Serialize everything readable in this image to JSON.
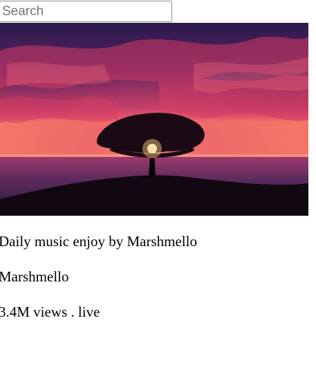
{
  "search": {
    "placeholder": "Search"
  },
  "video": {
    "thumbnail_alt": "Tree at sunset",
    "title": "Daily music enjoy by Marshmello",
    "channel": "Marshmello",
    "stats": "3.4M views . live"
  }
}
